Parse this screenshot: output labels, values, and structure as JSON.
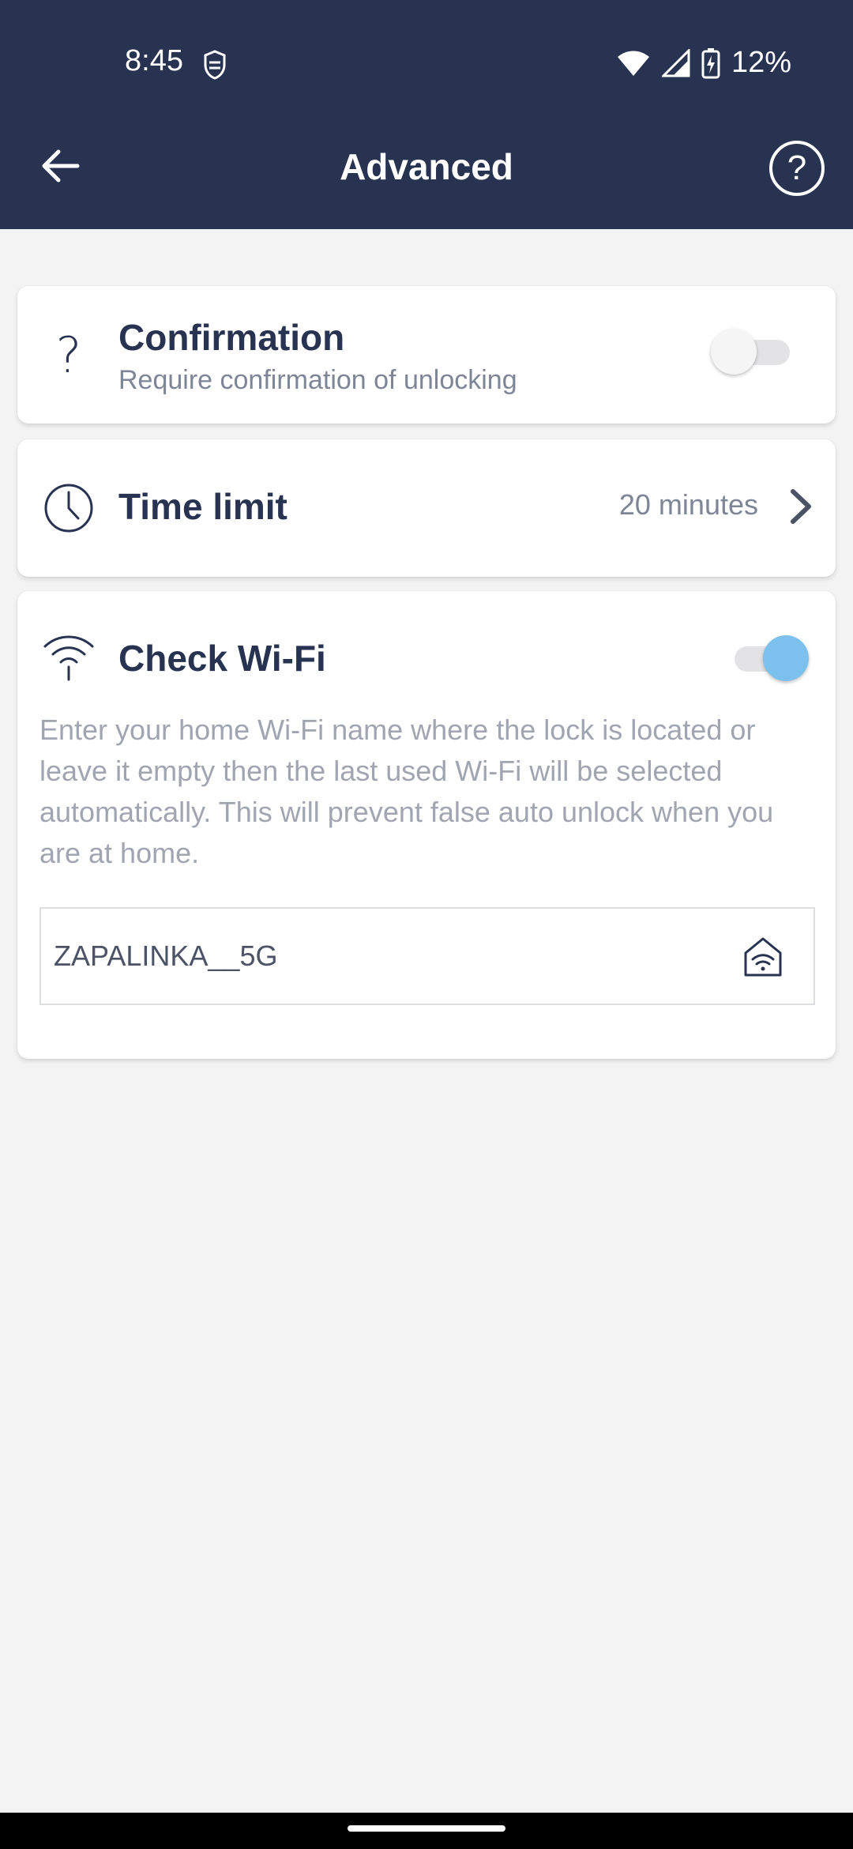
{
  "status_bar": {
    "time": "8:45",
    "battery": "12%"
  },
  "header": {
    "title": "Advanced",
    "help_icon": "?"
  },
  "confirmation": {
    "icon": "?",
    "title": "Confirmation",
    "subtitle": "Require confirmation of unlocking",
    "enabled": false
  },
  "time_limit": {
    "title": "Time limit",
    "value": "20 minutes"
  },
  "check_wifi": {
    "title": "Check Wi-Fi",
    "enabled": true,
    "description": "Enter your home Wi-Fi name where the lock is located or leave it empty then the last used Wi-Fi will be selected automatically. This will prevent false auto unlock when you are at home.",
    "field_value": "ZAPALINKA__5G"
  },
  "colors": {
    "header_bg": "#283352",
    "accent": "#7cc0ee",
    "page_bg": "#f3f3f4"
  }
}
